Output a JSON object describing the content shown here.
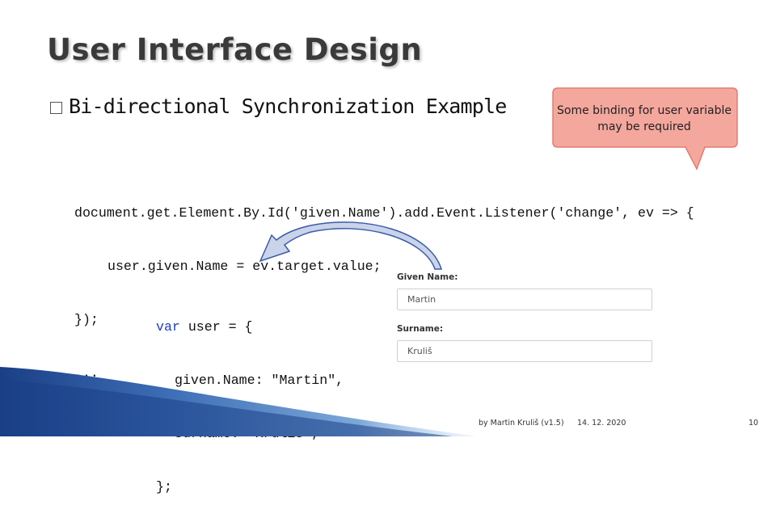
{
  "slide": {
    "title": "User Interface Design",
    "bullet": "Bi-directional Synchronization Example"
  },
  "callout": {
    "text": "Some binding for user variable may be required",
    "fill": "#f4a79d",
    "border": "#e37b6f"
  },
  "code_listener": {
    "line1": "document.get.Element.By.Id('given.Name').add.Event.Listener('change', ev => {",
    "line2": "user.given.Name = ev.target.value;",
    "line3": "});",
    "line4": "..."
  },
  "code_object": {
    "keyword": "var",
    "decl": " user = {",
    "prop1": "given.Name: \"Martin\",",
    "prop2": "surname: \"Kruliš\",",
    "close": "};",
    "keyword_color": "#1f3fbf"
  },
  "form": {
    "given_name_label": "Given Name:",
    "given_name_value": "Martin",
    "surname_label": "Surname:",
    "surname_value": "Kruliš"
  },
  "footer": {
    "author": "by Martin Kruliš (v1.5)",
    "date": "14. 12. 2020",
    "page": "10"
  },
  "colors": {
    "arrow_fill": "#c9d3ea",
    "arrow_stroke": "#3c5aa6",
    "deco_dark": "#1a3f86",
    "deco_light": "#7ba7d8"
  }
}
